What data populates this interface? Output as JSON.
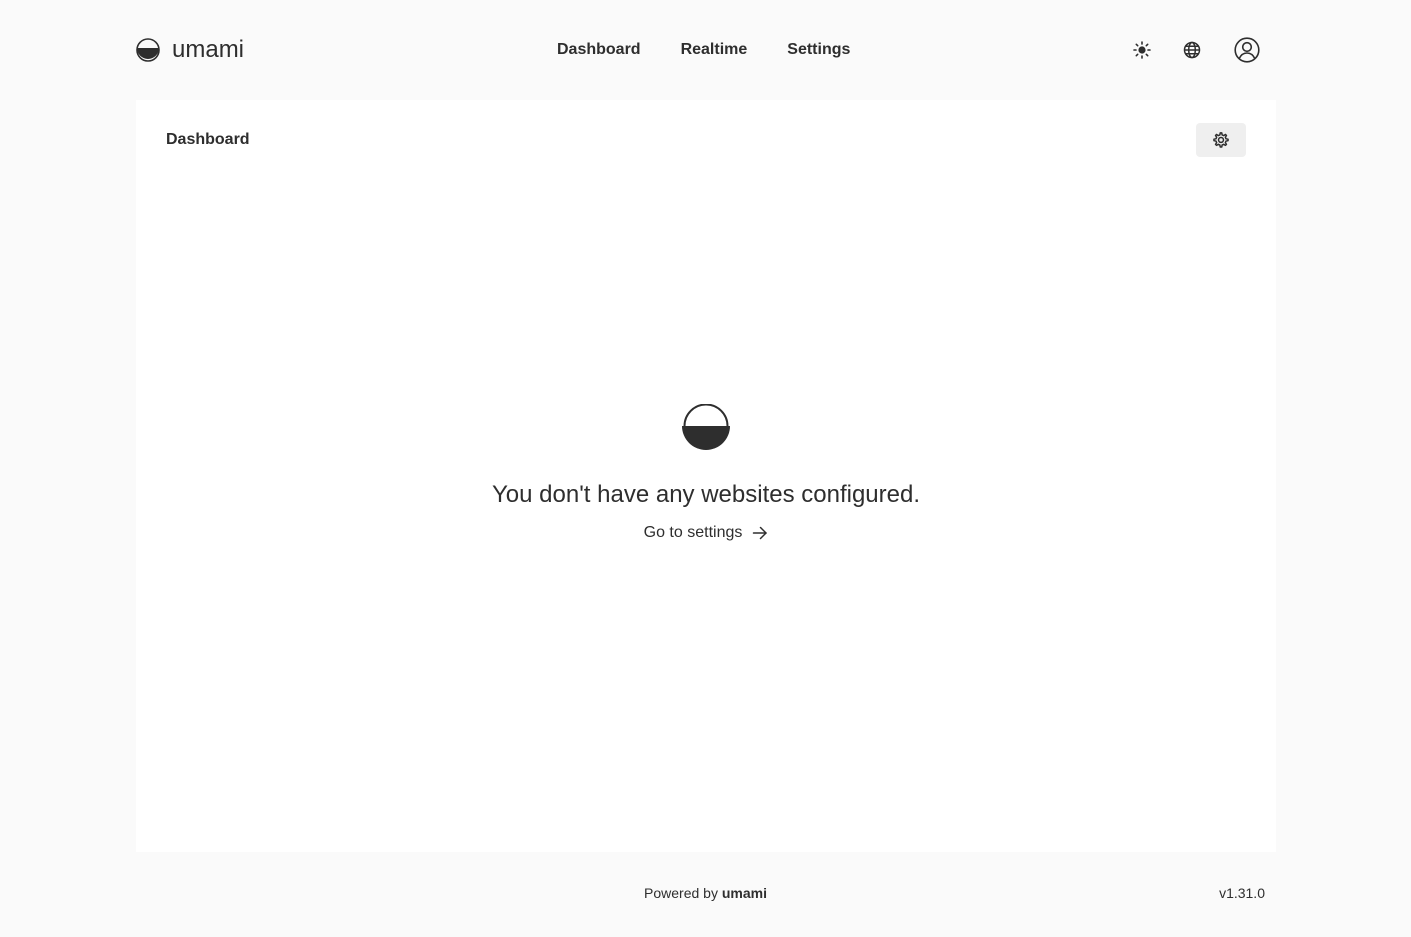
{
  "app": {
    "name": "umami"
  },
  "nav": {
    "items": [
      "Dashboard",
      "Realtime",
      "Settings"
    ]
  },
  "header_icons": [
    "sun-icon",
    "globe-icon",
    "user-icon"
  ],
  "main": {
    "title": "Dashboard",
    "settings_icon": "gear-icon",
    "empty_state": {
      "message": "You don't have any websites configured.",
      "link_label": "Go to settings",
      "link_icon": "arrow-right-icon"
    }
  },
  "footer": {
    "powered_prefix": "Powered by",
    "powered_brand": "umami",
    "version": "v1.31.0"
  },
  "colors": {
    "background": "#fafafa",
    "card": "#ffffff",
    "text": "#2e2e2e",
    "button_bg": "#efefef"
  }
}
